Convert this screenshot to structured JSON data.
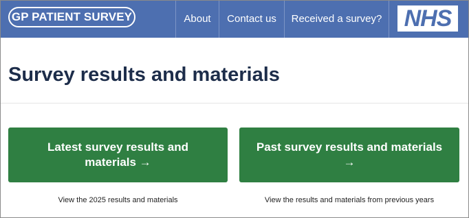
{
  "header": {
    "logo_text": "GP PATIENT SURVEY",
    "nav": [
      "About",
      "Contact us",
      "Received a survey?"
    ],
    "nhs_logo": "NHS"
  },
  "main": {
    "title": "Survey results and materials",
    "cards": [
      {
        "label": "Latest survey results and materials →",
        "caption": "View the 2025 results and materials"
      },
      {
        "label": "Past survey results and materials →",
        "caption": "View the results and materials from previous years"
      }
    ]
  },
  "colors": {
    "header_bg": "#4d6fb0",
    "button_green": "#2f7f42",
    "title_text": "#1d2d4a"
  }
}
